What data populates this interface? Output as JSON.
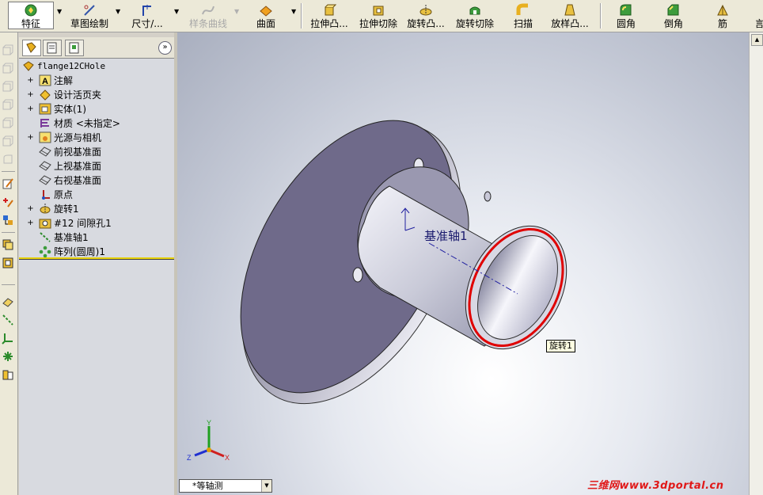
{
  "toolbar": {
    "items": [
      {
        "label": "特征"
      },
      {
        "label": "草图绘制"
      },
      {
        "label": "尺寸/..."
      },
      {
        "label": "样条曲线"
      },
      {
        "label": "曲面"
      },
      {
        "label": "拉伸凸..."
      },
      {
        "label": "拉伸切除"
      },
      {
        "label": "旋转凸..."
      },
      {
        "label": "旋转切除"
      },
      {
        "label": "扫描"
      },
      {
        "label": "放样凸..."
      },
      {
        "label": "圆角"
      },
      {
        "label": "倒角"
      },
      {
        "label": "筋"
      }
    ],
    "edge_label": "言"
  },
  "feature_tree": {
    "root": "flange12CHole",
    "items": [
      {
        "label": "注解",
        "icon": "annotation-icon"
      },
      {
        "label": "设计活页夹",
        "icon": "design-binder-icon"
      },
      {
        "label": "实体(1)",
        "icon": "solid-bodies-icon"
      },
      {
        "label": "材质 <未指定>",
        "icon": "material-icon"
      },
      {
        "label": "光源与相机",
        "icon": "lights-cameras-icon"
      },
      {
        "label": "前视基准面",
        "icon": "plane-icon"
      },
      {
        "label": "上视基准面",
        "icon": "plane-icon"
      },
      {
        "label": "右视基准面",
        "icon": "plane-icon"
      },
      {
        "label": "原点",
        "icon": "origin-icon"
      },
      {
        "label": "旋转1",
        "icon": "revolve-icon"
      },
      {
        "label": "#12 间隙孔1",
        "icon": "hole-wizard-icon"
      },
      {
        "label": "基准轴1",
        "icon": "axis-icon"
      },
      {
        "label": "阵列(圆周)1",
        "icon": "circular-pattern-icon"
      }
    ]
  },
  "viewport": {
    "axis_label": "基准轴1",
    "tooltip": "旋转1",
    "view_orientation": "*等轴测",
    "triad": {
      "x": "X",
      "y": "Y",
      "z": "Z"
    },
    "watermark": "三维网www.3dportal.cn"
  },
  "colors": {
    "part_face": "#6f6a8a",
    "part_light": "#d9dae6",
    "edge_highlight": "#e00000",
    "watermark": "#e01818"
  }
}
